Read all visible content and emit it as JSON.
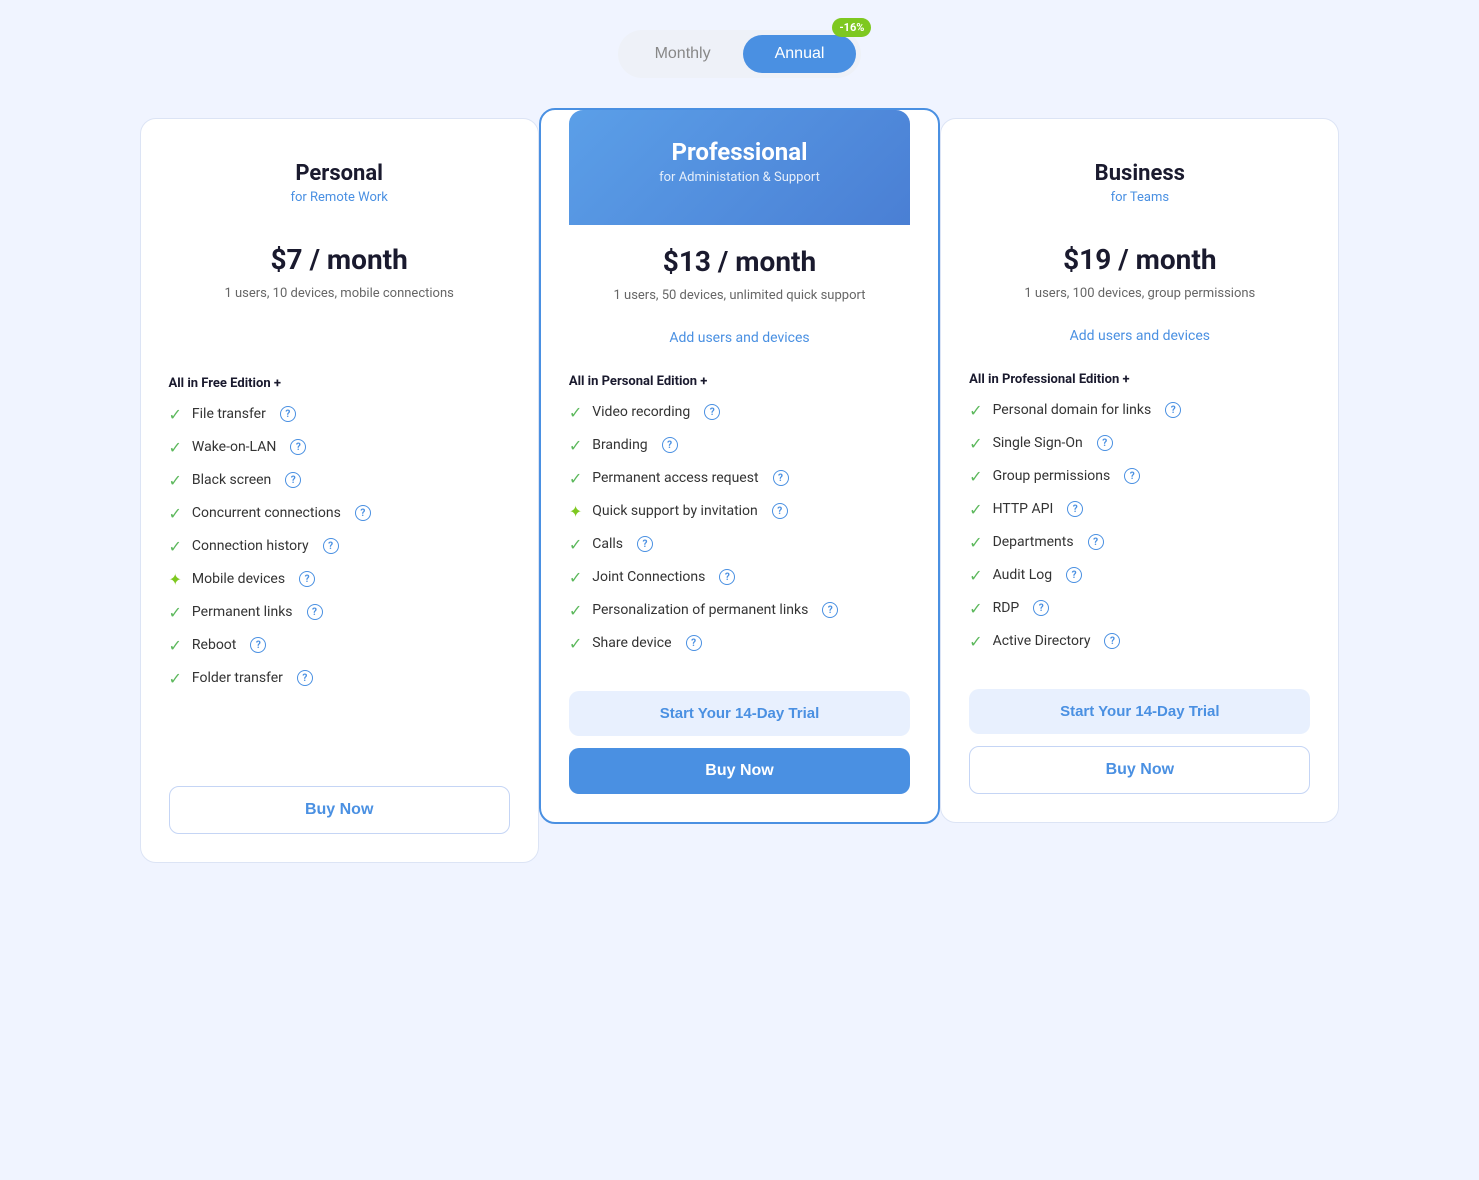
{
  "toggle": {
    "monthly_label": "Monthly",
    "annual_label": "Annual",
    "discount": "-16%",
    "active": "annual"
  },
  "plans": [
    {
      "id": "personal",
      "name": "Personal",
      "tagline": "for Remote Work",
      "price": "$7 / month",
      "description": "1 users, 10 devices, mobile connections",
      "add_users": null,
      "features_heading": "All in Free Edition +",
      "features": [
        {
          "text": "File transfer",
          "icon": "check",
          "help": true
        },
        {
          "text": "Wake-on-LAN",
          "icon": "check",
          "help": true
        },
        {
          "text": "Black screen",
          "icon": "check",
          "help": true
        },
        {
          "text": "Concurrent connections",
          "icon": "check",
          "help": true
        },
        {
          "text": "Connection history",
          "icon": "check",
          "help": true
        },
        {
          "text": "Mobile devices",
          "icon": "star",
          "help": true
        },
        {
          "text": "Permanent links",
          "icon": "check",
          "help": true
        },
        {
          "text": "Reboot",
          "icon": "check",
          "help": true
        },
        {
          "text": "Folder transfer",
          "icon": "check",
          "help": true
        }
      ],
      "trial_label": null,
      "buy_label": "Buy Now",
      "featured": false
    },
    {
      "id": "professional",
      "name": "Professional",
      "tagline": "for Administation & Support",
      "price": "$13 / month",
      "description": "1 users, 50 devices, unlimited quick support",
      "add_users": "Add users and devices",
      "features_heading": "All in Personal Edition +",
      "features": [
        {
          "text": "Video recording",
          "icon": "check",
          "help": true
        },
        {
          "text": "Branding",
          "icon": "check",
          "help": true
        },
        {
          "text": "Permanent access request",
          "icon": "check",
          "help": true
        },
        {
          "text": "Quick support by invitation",
          "icon": "star",
          "help": true
        },
        {
          "text": "Calls",
          "icon": "check",
          "help": true
        },
        {
          "text": "Joint Connections",
          "icon": "check",
          "help": true
        },
        {
          "text": "Personalization of permanent links",
          "icon": "check",
          "help": true
        },
        {
          "text": "Share device",
          "icon": "check",
          "help": true
        }
      ],
      "trial_label": "Start Your 14-Day Trial",
      "buy_label": "Buy Now",
      "featured": true
    },
    {
      "id": "business",
      "name": "Business",
      "tagline": "for Teams",
      "price": "$19 / month",
      "description": "1 users, 100 devices, group permissions",
      "add_users": "Add users and devices",
      "features_heading": "All in Professional Edition +",
      "features": [
        {
          "text": "Personal domain for links",
          "icon": "check",
          "help": true
        },
        {
          "text": "Single Sign-On",
          "icon": "check",
          "help": true
        },
        {
          "text": "Group permissions",
          "icon": "check",
          "help": true
        },
        {
          "text": "HTTP API",
          "icon": "check",
          "help": true
        },
        {
          "text": "Departments",
          "icon": "check",
          "help": true
        },
        {
          "text": "Audit Log",
          "icon": "check",
          "help": true
        },
        {
          "text": "RDP",
          "icon": "check",
          "help": true
        },
        {
          "text": "Active Directory",
          "icon": "check",
          "help": true
        }
      ],
      "trial_label": "Start Your 14-Day Trial",
      "buy_label": "Buy Now",
      "featured": false
    }
  ]
}
